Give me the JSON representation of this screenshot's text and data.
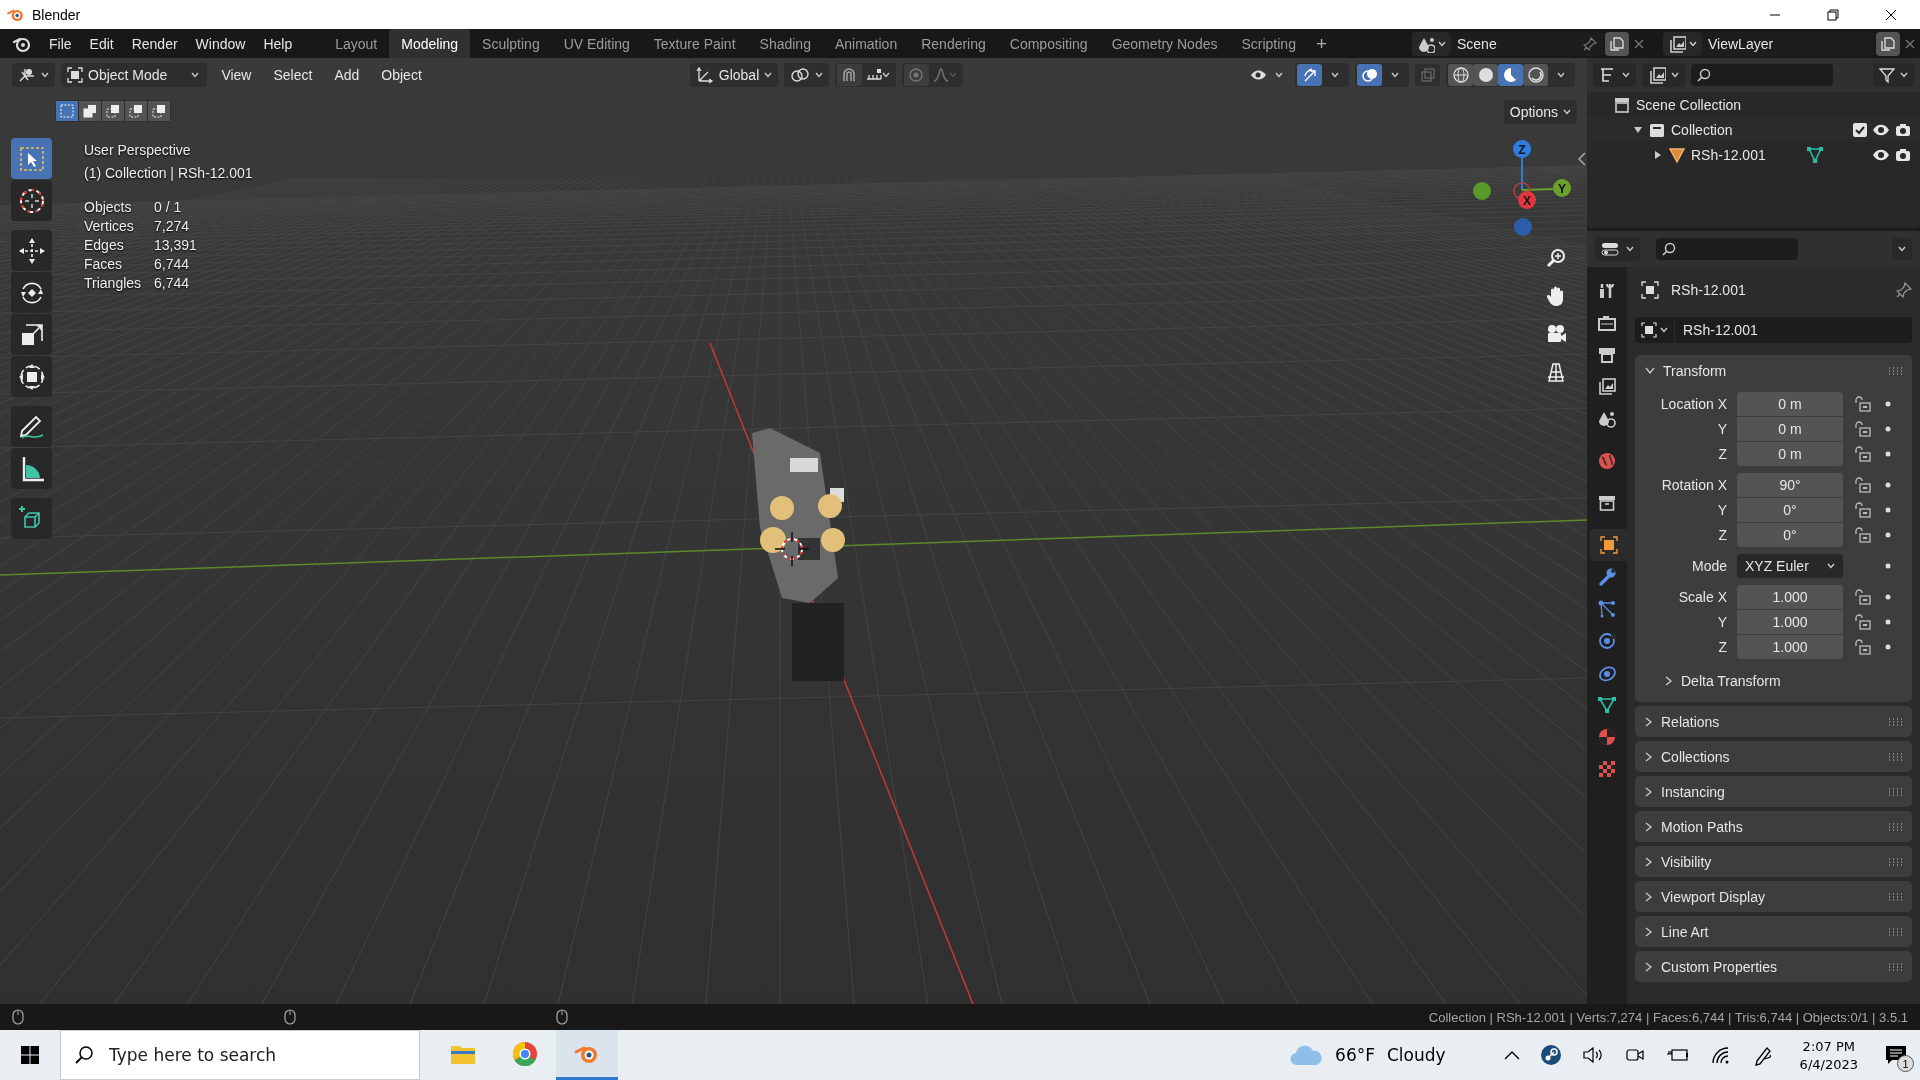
{
  "window": {
    "title": "Blender"
  },
  "menu": [
    "File",
    "Edit",
    "Render",
    "Window",
    "Help"
  ],
  "workspaces": [
    {
      "label": "Layout",
      "selected": false
    },
    {
      "label": "Modeling",
      "selected": true
    },
    {
      "label": "Sculpting",
      "selected": false
    },
    {
      "label": "UV Editing",
      "selected": false
    },
    {
      "label": "Texture Paint",
      "selected": false
    },
    {
      "label": "Shading",
      "selected": false
    },
    {
      "label": "Animation",
      "selected": false
    },
    {
      "label": "Rendering",
      "selected": false
    },
    {
      "label": "Compositing",
      "selected": false
    },
    {
      "label": "Geometry Nodes",
      "selected": false
    },
    {
      "label": "Scripting",
      "selected": false
    }
  ],
  "add_workspace": "+",
  "scene": {
    "name": "Scene"
  },
  "view_layer": {
    "name": "ViewLayer"
  },
  "viewport": {
    "mode": "Object Mode",
    "menus": [
      "View",
      "Select",
      "Add",
      "Object"
    ],
    "orientation": "Global",
    "options": "Options",
    "select_modes": [
      {
        "selected": true
      },
      {
        "selected": false
      },
      {
        "selected": false
      },
      {
        "selected": false
      },
      {
        "selected": false
      }
    ],
    "shading": [
      {
        "kind": "wireframe",
        "selected": false
      },
      {
        "kind": "solid",
        "selected": false
      },
      {
        "kind": "material",
        "selected": true
      },
      {
        "kind": "rendered",
        "selected": false
      }
    ],
    "tools": [
      {
        "kind": "select",
        "selected": true
      },
      {
        "kind": "cursor",
        "selected": false
      },
      {
        "kind": "move",
        "selected": false
      },
      {
        "kind": "rotate",
        "selected": false
      },
      {
        "kind": "scale",
        "selected": false
      },
      {
        "kind": "transform",
        "selected": false
      },
      {
        "kind": "annotate",
        "selected": false
      },
      {
        "kind": "measure",
        "selected": false
      },
      {
        "kind": "add_cube",
        "selected": false
      }
    ],
    "view_name": "User Perspective",
    "context": "(1) Collection | RSh-12.001",
    "stats": [
      {
        "label": "Objects",
        "value": "0 / 1"
      },
      {
        "label": "Vertices",
        "value": "7,274"
      },
      {
        "label": "Edges",
        "value": "13,391"
      },
      {
        "label": "Faces",
        "value": "6,744"
      },
      {
        "label": "Triangles",
        "value": "6,744"
      }
    ],
    "gizmo_axes": [
      "Z",
      "Y",
      "X"
    ]
  },
  "outliner": {
    "items": [
      {
        "label": "Scene Collection",
        "kind": "scene_collection",
        "children": [
          {
            "label": "Collection",
            "kind": "collection",
            "expanded": true,
            "children": [
              {
                "label": "RSh-12.001",
                "kind": "object",
                "expanded": false
              }
            ]
          }
        ]
      }
    ]
  },
  "properties": {
    "tabs": [
      {
        "kind": "tool",
        "selected": false
      },
      {
        "kind": "render",
        "selected": false
      },
      {
        "kind": "output",
        "selected": false
      },
      {
        "kind": "view_layer",
        "selected": false
      },
      {
        "kind": "scene",
        "selected": false
      },
      {
        "kind": "world",
        "selected": false
      },
      {
        "kind": "collection",
        "selected": false
      },
      {
        "kind": "object",
        "selected": true
      },
      {
        "kind": "modifiers",
        "selected": false
      },
      {
        "kind": "particles",
        "selected": false
      },
      {
        "kind": "physics",
        "selected": false
      },
      {
        "kind": "constraints",
        "selected": false
      },
      {
        "kind": "data",
        "selected": false
      },
      {
        "kind": "material",
        "selected": false
      },
      {
        "kind": "texture",
        "selected": false
      }
    ],
    "object_name": "RSh-12.001",
    "data_name": "RSh-12.001",
    "transform": {
      "title": "Transform",
      "expanded": true,
      "groups": [
        {
          "kind": "values",
          "rows": [
            {
              "label": "Location X",
              "value": "0 m"
            },
            {
              "label": "Y",
              "value": "0 m"
            },
            {
              "label": "Z",
              "value": "0 m"
            }
          ]
        },
        {
          "kind": "values",
          "rows": [
            {
              "label": "Rotation X",
              "value": "90°"
            },
            {
              "label": "Y",
              "value": "0°"
            },
            {
              "label": "Z",
              "value": "0°"
            }
          ]
        },
        {
          "kind": "dropdown",
          "label": "Mode",
          "value": "XYZ Euler"
        },
        {
          "kind": "values",
          "rows": [
            {
              "label": "Scale X",
              "value": "1.000"
            },
            {
              "label": "Y",
              "value": "1.000"
            },
            {
              "label": "Z",
              "value": "1.000"
            }
          ]
        }
      ],
      "subpanels": [
        {
          "label": "Delta Transform",
          "expanded": false
        }
      ]
    },
    "panels": [
      {
        "label": "Relations",
        "expanded": false
      },
      {
        "label": "Collections",
        "expanded": false
      },
      {
        "label": "Instancing",
        "expanded": false
      },
      {
        "label": "Motion Paths",
        "expanded": false
      },
      {
        "label": "Visibility",
        "expanded": false
      },
      {
        "label": "Viewport Display",
        "expanded": false
      },
      {
        "label": "Line Art",
        "expanded": false
      },
      {
        "label": "Custom Properties",
        "expanded": false
      }
    ]
  },
  "status_bar": {
    "text": "Collection | RSh-12.001 | Verts:7,274 | Faces:6,744 | Tris:6,744 | Objects:0/1 | 3.5.1"
  },
  "taskbar": {
    "search": {
      "placeholder": "Type here to search"
    },
    "apps": [
      {
        "kind": "explorer",
        "selected": false
      },
      {
        "kind": "chrome",
        "selected": false
      },
      {
        "kind": "blender",
        "selected": true
      }
    ],
    "temperature": "66°F",
    "condition": "Cloudy",
    "time": "2:07 PM",
    "date": "6/4/2023",
    "notifications": "1"
  }
}
